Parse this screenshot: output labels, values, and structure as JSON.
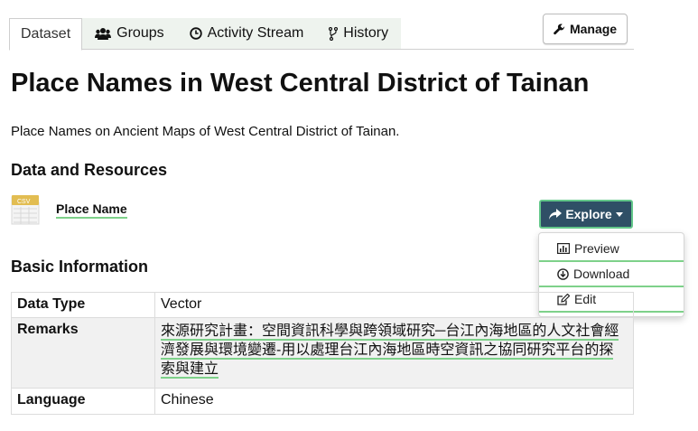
{
  "tabs": [
    {
      "label": "Dataset",
      "icon": "none",
      "active": true
    },
    {
      "label": "Groups",
      "icon": "users-icon",
      "active": false
    },
    {
      "label": "Activity Stream",
      "icon": "clock-icon",
      "active": false
    },
    {
      "label": "History",
      "icon": "code-fork-icon",
      "active": false
    }
  ],
  "manage": {
    "label": "Manage",
    "icon": "wrench-icon"
  },
  "dataset": {
    "title": "Place Names in West Central District of Tainan",
    "notes": "Place Names on Ancient Maps of West Central District of Tainan."
  },
  "resources": {
    "heading": "Data and Resources",
    "items": [
      {
        "name": "Place Name",
        "format": "csv",
        "explore_label": "Explore"
      }
    ],
    "dropdown": [
      {
        "label": "Preview",
        "icon": "bar-chart-icon"
      },
      {
        "label": "Download",
        "icon": "download-icon"
      },
      {
        "label": "Edit",
        "icon": "edit-icon"
      }
    ]
  },
  "basic_info": {
    "heading": "Basic Information",
    "rows": [
      {
        "key": "Data Type",
        "value": "Vector"
      },
      {
        "key": "Remarks",
        "value": "來源研究計畫：空間資訊科學與跨領域研究─台江內海地區的人文社會經濟發展與環境變遷-用以處理台江內海地區時空資訊之協同研究平台的探索與建立"
      },
      {
        "key": "Language",
        "value": "Chinese"
      }
    ]
  },
  "colors": {
    "accent_underline": "#7ed18a",
    "explore_bg": "#2f4f66",
    "tab_bg": "#eef3ee"
  }
}
